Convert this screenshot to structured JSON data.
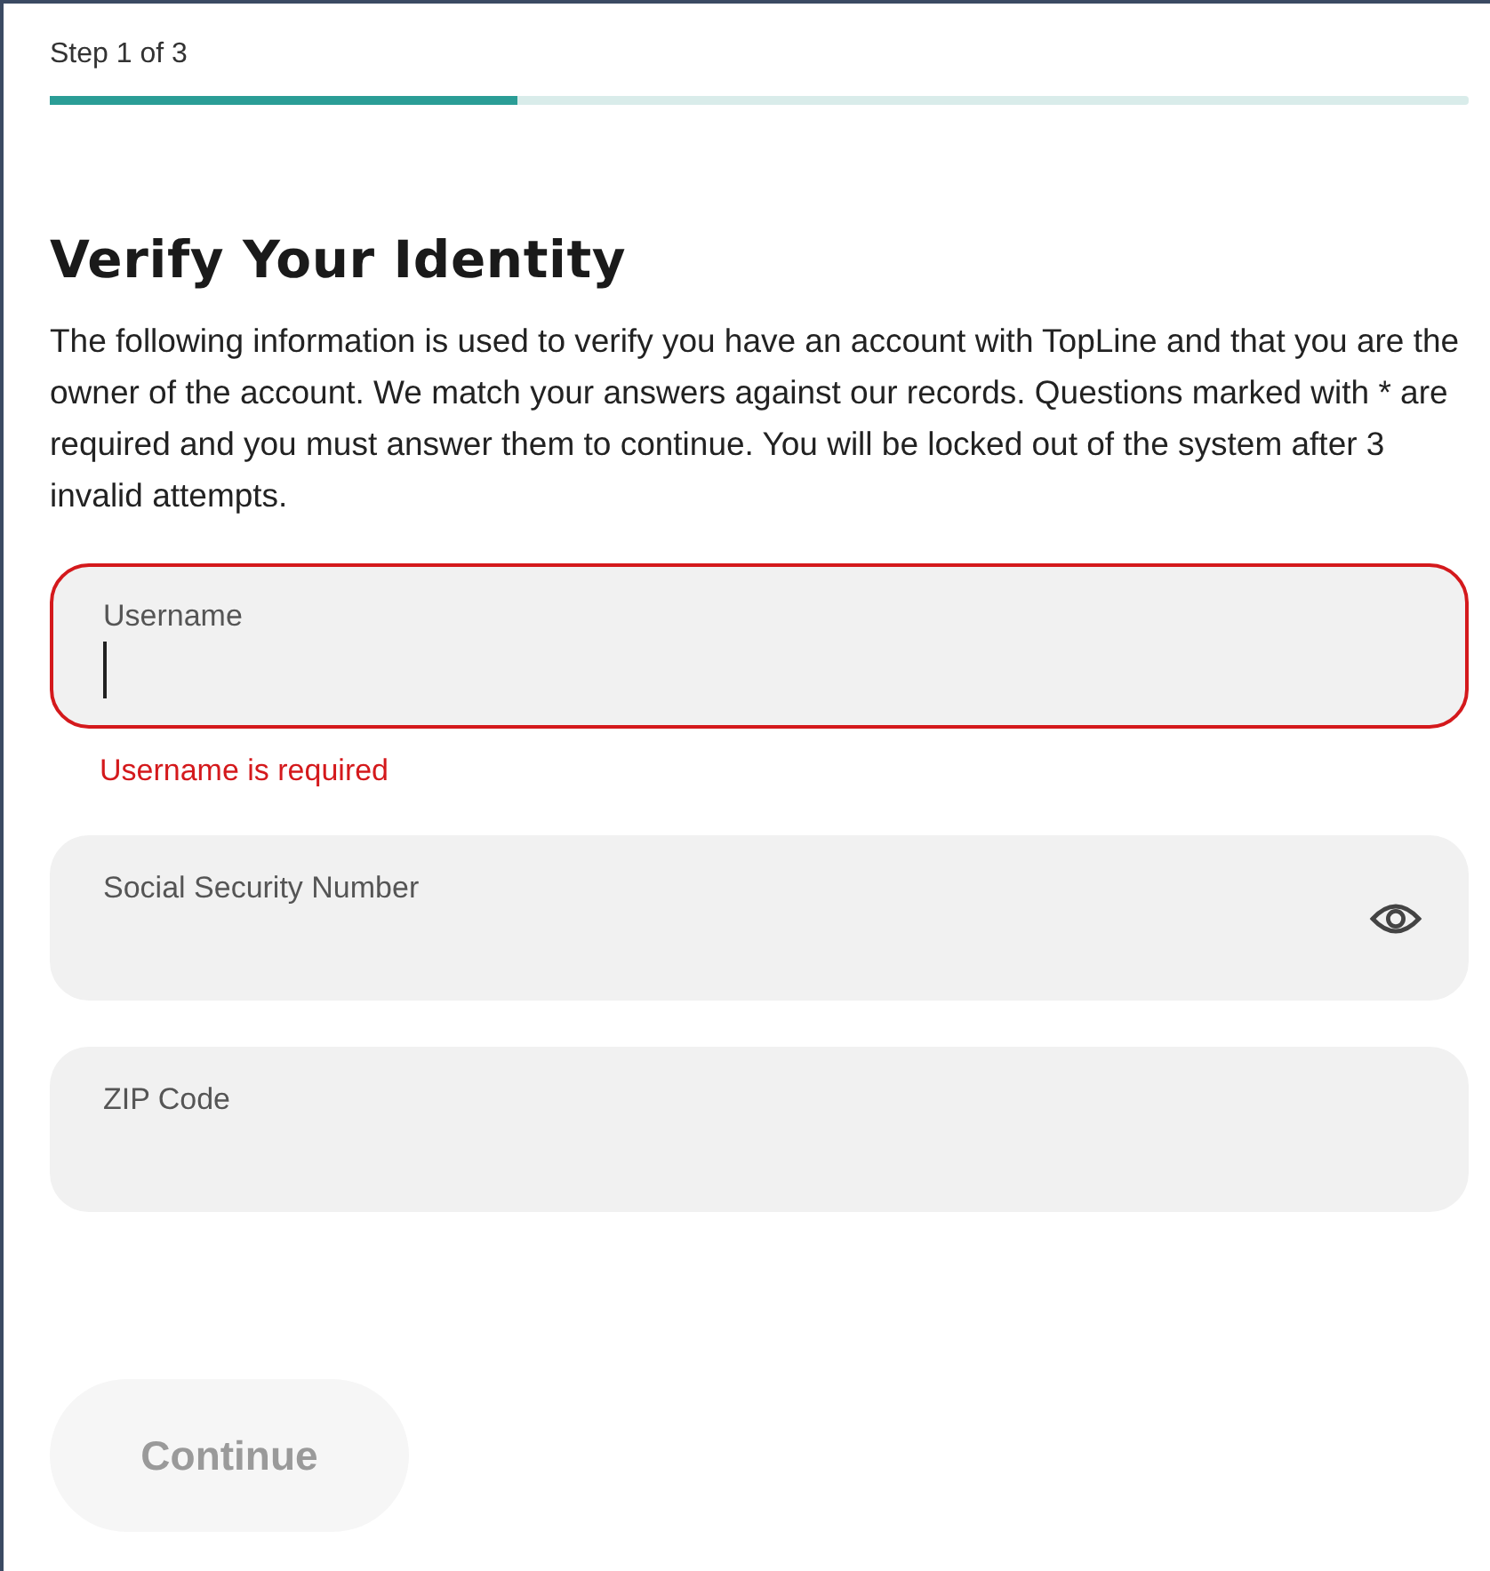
{
  "progress": {
    "label": "Step 1 of 3",
    "level": 0.33
  },
  "title": "Verify Your Identity",
  "description": "The following information is used to verify you have an account with TopLine and that you are the owner of the account. We match your answers against our records. Questions marked with * are required and you must answer them to continue. You will be locked out of the system after 3 invalid attempts.",
  "fields": [
    {
      "kind": "text",
      "label": "Username",
      "focused": true,
      "invalid": true,
      "error": "Username is required"
    },
    {
      "kind": "secret",
      "label": "Social Security Number",
      "focused": false,
      "invalid": false
    },
    {
      "kind": "text",
      "label": "ZIP Code",
      "focused": false,
      "invalid": false
    }
  ],
  "continue_button": {
    "label": "Continue",
    "disabled": true
  }
}
